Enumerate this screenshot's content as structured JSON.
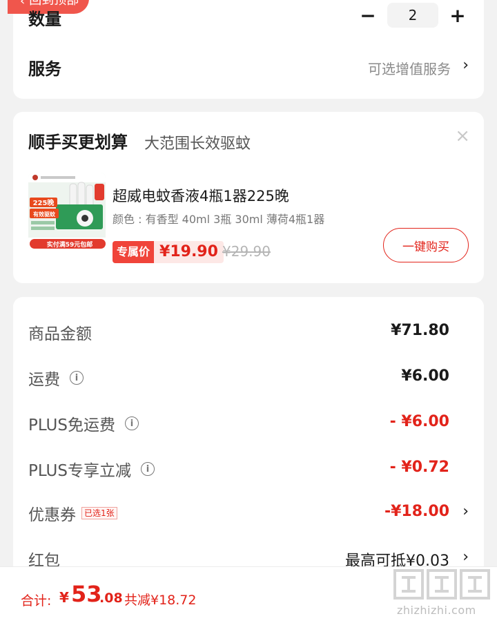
{
  "back_pill": {
    "label": "回到顶部"
  },
  "quantity": {
    "label": "数量",
    "value": "2",
    "minus": "−",
    "plus": "+"
  },
  "service": {
    "label": "服务",
    "value": "可选增值服务",
    "chevron": "›"
  },
  "bundle": {
    "title": "顺手买更划算",
    "subtitle": "大范围长效驱蚊",
    "close": "×",
    "product": {
      "name": "超威电蚊香液4瓶1器225晚",
      "spec": "颜色 : 有香型 40ml 3瓶 30ml 薄荷4瓶1器",
      "badge": "专属价",
      "price": "¥19.90",
      "original_price": "¥29.90",
      "buy_button": "一键购买",
      "image_text": {
        "tag": "225晚",
        "line1": "有效驱蚊",
        "promo": "实付满59元包邮"
      }
    }
  },
  "costs": [
    {
      "label": "商品金额",
      "value": "¥71.80",
      "info": false,
      "style": "normal"
    },
    {
      "label": "运费",
      "value": "¥6.00",
      "info": true,
      "style": "normal"
    },
    {
      "label": "PLUS免运费",
      "value": "- ¥6.00",
      "info": true,
      "style": "red"
    },
    {
      "label": "PLUS专享立减",
      "value": "- ¥0.72",
      "info": true,
      "style": "red"
    },
    {
      "label": "优惠券",
      "badge": "已选1张",
      "value": "-¥18.00",
      "chevron": "›",
      "style": "red"
    },
    {
      "label": "红包",
      "value": "最高可抵¥0.03",
      "chevron": "›",
      "style": "dark"
    }
  ],
  "total": {
    "label": "合计:",
    "currency": "¥",
    "integer": "53",
    "decimal": ".08",
    "saved": "共减¥18.72"
  },
  "watermark": {
    "text": "zhizhizhi.com"
  },
  "colors": {
    "accent": "#e2231a",
    "background": "#f2f2f2",
    "card": "#ffffff"
  }
}
